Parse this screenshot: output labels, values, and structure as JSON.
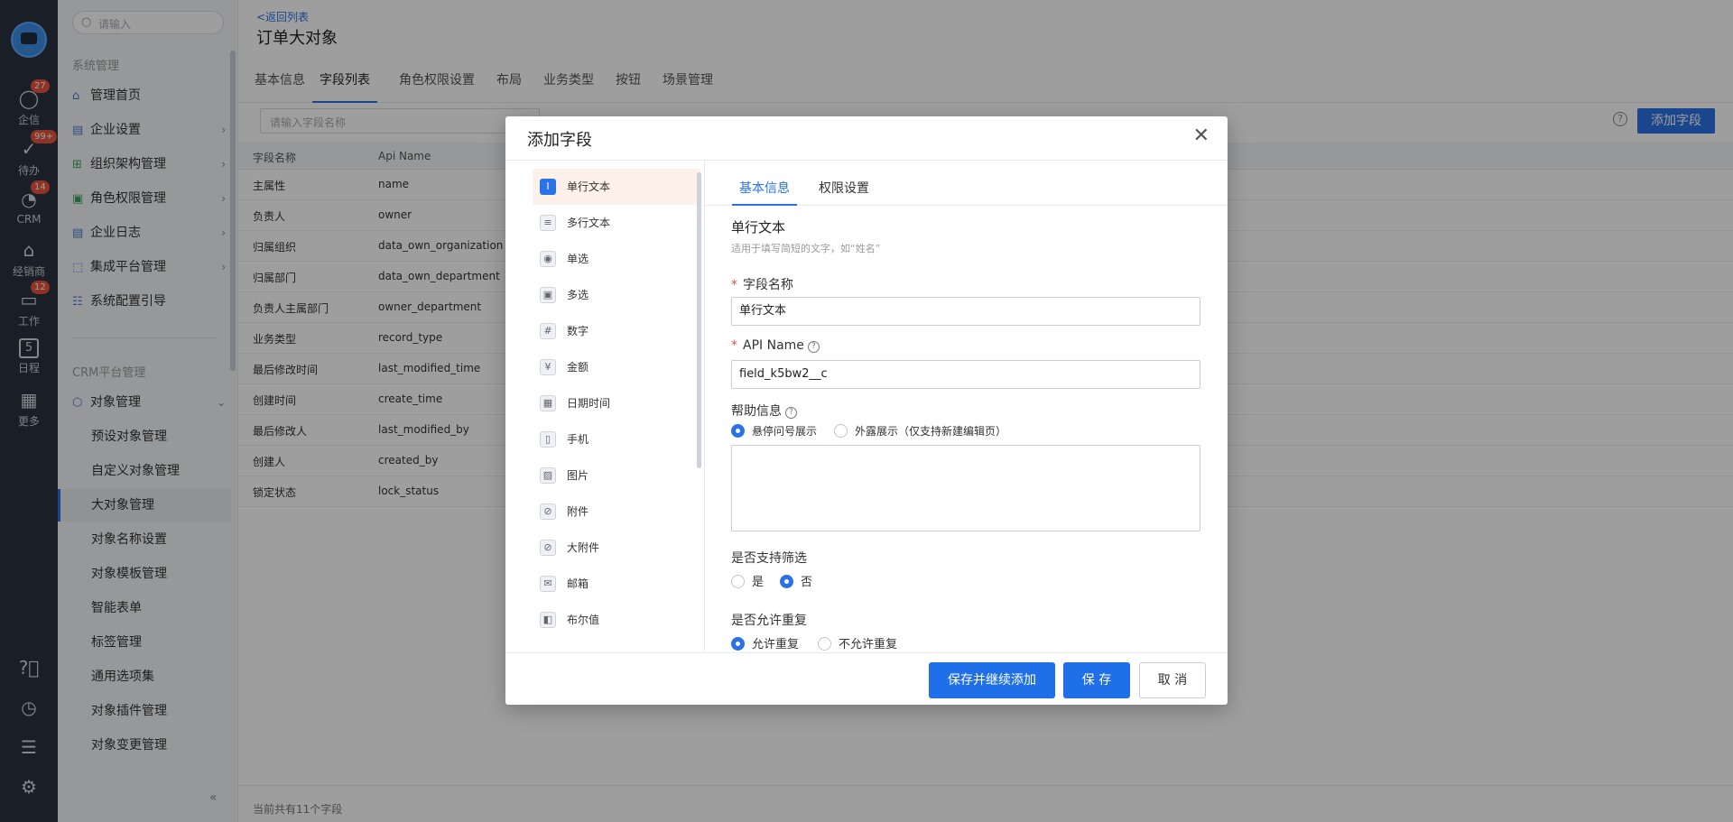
{
  "rail": {
    "items": [
      {
        "label": "企信",
        "icon": "chat-icon",
        "badge": "27"
      },
      {
        "label": "待办",
        "icon": "check-icon",
        "badge": "99+"
      },
      {
        "label": "CRM",
        "icon": "pie-icon",
        "badge": "14"
      },
      {
        "label": "经销商",
        "icon": "store-icon",
        "badge": ""
      },
      {
        "label": "工作",
        "icon": "briefcase-icon",
        "badge": "12"
      },
      {
        "label": "日程",
        "icon": "calendar-icon",
        "badge": ""
      },
      {
        "label": "更多",
        "icon": "grid-icon",
        "badge": ""
      }
    ],
    "calendar_day": "5"
  },
  "nav": {
    "search_placeholder": "请输入",
    "group1": "系统管理",
    "items": [
      {
        "label": "管理首页"
      },
      {
        "label": "企业设置"
      },
      {
        "label": "组织架构管理"
      },
      {
        "label": "角色权限管理"
      },
      {
        "label": "企业日志"
      },
      {
        "label": "集成平台管理"
      },
      {
        "label": "系统配置引导"
      }
    ],
    "group2": "CRM平台管理",
    "object_mgmt": "对象管理",
    "subitems": [
      {
        "label": "预设对象管理"
      },
      {
        "label": "自定义对象管理"
      },
      {
        "label": "大对象管理"
      },
      {
        "label": "对象名称设置"
      },
      {
        "label": "对象模板管理"
      },
      {
        "label": "智能表单"
      },
      {
        "label": "标签管理"
      },
      {
        "label": "通用选项集"
      },
      {
        "label": "对象插件管理"
      },
      {
        "label": "对象变更管理"
      }
    ]
  },
  "page": {
    "back": "<返回列表",
    "title": "订单大对象",
    "tabs": [
      "基本信息",
      "字段列表",
      "角色权限设置",
      "布局",
      "业务类型",
      "按钮",
      "场景管理"
    ],
    "search_placeholder": "请输入字段名称",
    "add_field": "添加字段",
    "columns": [
      "字段名称",
      "Api Name"
    ],
    "rows": [
      [
        "主属性",
        "name"
      ],
      [
        "负责人",
        "owner"
      ],
      [
        "归属组织",
        "data_own_organization"
      ],
      [
        "归属部门",
        "data_own_department"
      ],
      [
        "负责人主属部门",
        "owner_department"
      ],
      [
        "业务类型",
        "record_type"
      ],
      [
        "最后修改时间",
        "last_modified_time"
      ],
      [
        "创建时间",
        "create_time"
      ],
      [
        "最后修改人",
        "last_modified_by"
      ],
      [
        "创建人",
        "created_by"
      ],
      [
        "锁定状态",
        "lock_status"
      ]
    ],
    "footer": "当前共有11个字段"
  },
  "modal": {
    "title": "添加字段",
    "types": [
      {
        "label": "单行文本",
        "icon": "I"
      },
      {
        "label": "多行文本",
        "icon": "≡"
      },
      {
        "label": "单选",
        "icon": "◉"
      },
      {
        "label": "多选",
        "icon": "▣"
      },
      {
        "label": "数字",
        "icon": "#"
      },
      {
        "label": "金额",
        "icon": "¥"
      },
      {
        "label": "日期时间",
        "icon": "▦"
      },
      {
        "label": "手机",
        "icon": "▯"
      },
      {
        "label": "图片",
        "icon": "▨"
      },
      {
        "label": "附件",
        "icon": "⊘"
      },
      {
        "label": "大附件",
        "icon": "⊘"
      },
      {
        "label": "邮箱",
        "icon": "✉"
      },
      {
        "label": "布尔值",
        "icon": "◧"
      }
    ],
    "tabs": [
      "基本信息",
      "权限设置"
    ],
    "form": {
      "section_title": "单行文本",
      "section_desc": "适用于填写简短的文字，如“姓名”",
      "field_name_label": "字段名称",
      "field_name_value": "单行文本",
      "api_name_label": "API Name",
      "api_name_value": "field_k5bw2__c",
      "help_label": "帮助信息",
      "help_opt1": "悬停问号展示",
      "help_opt2": "外露展示（仅支持新建编辑页）",
      "filter_label": "是否支持筛选",
      "filter_yes": "是",
      "filter_no": "否",
      "dup_label": "是否允许重复",
      "dup_yes": "允许重复",
      "dup_no": "不允许重复"
    },
    "buttons": {
      "save_continue": "保存并继续添加",
      "save": "保 存",
      "cancel": "取 消"
    }
  },
  "colors": {
    "accent": "#2a72e5",
    "rail_bg": "#2b3340",
    "badge": "#e5533d"
  }
}
